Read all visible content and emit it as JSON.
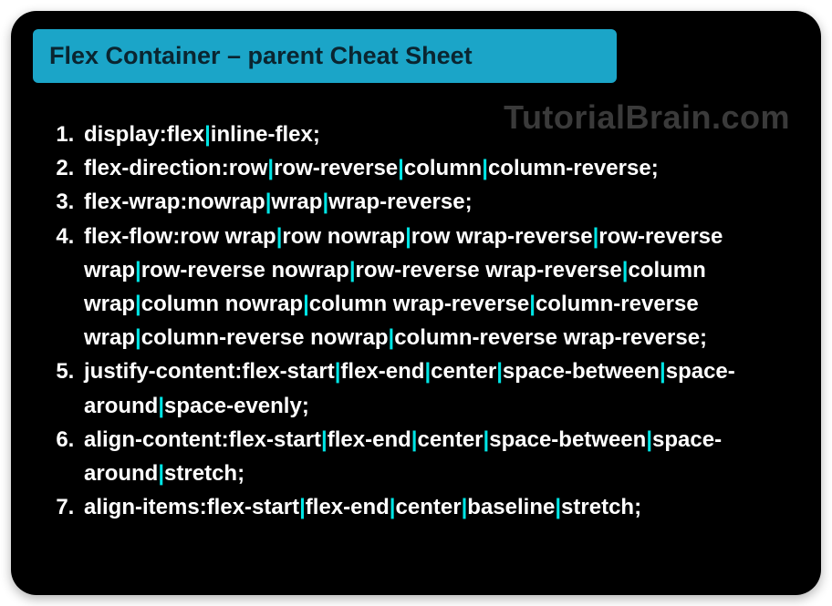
{
  "title": "Flex Container – parent Cheat Sheet",
  "watermark": "TutorialBrain.com",
  "separator": "|",
  "items": [
    {
      "prop": "display:",
      "values": [
        "flex",
        "inline-flex"
      ],
      "end": ";"
    },
    {
      "prop": "flex-direction:",
      "values": [
        "row",
        "row-reverse",
        "column",
        "column-reverse"
      ],
      "end": ";"
    },
    {
      "prop": "flex-wrap:",
      "values": [
        "nowrap",
        "wrap",
        "wrap-reverse"
      ],
      "end": ";"
    },
    {
      "prop": "flex-flow:",
      "values": [
        "row wrap",
        "row nowrap",
        "row wrap-reverse",
        "row-reverse wrap",
        "row-reverse nowrap",
        "row-reverse wrap-reverse",
        "column wrap",
        "column nowrap",
        "column wrap-reverse",
        "column-reverse wrap",
        "column-reverse nowrap",
        "column-reverse wrap-reverse"
      ],
      "end": ";"
    },
    {
      "prop": "justify-content:",
      "values": [
        "flex-start",
        "flex-end",
        "center",
        "space-between",
        "space-around",
        "space-evenly"
      ],
      "end": ";"
    },
    {
      "prop": "align-content:",
      "values": [
        "flex-start",
        "flex-end",
        "center",
        "space-between",
        "space-around",
        "stretch"
      ],
      "end": ";"
    },
    {
      "prop": "align-items:",
      "values": [
        "flex-start",
        "flex-end",
        "center",
        "baseline",
        "stretch"
      ],
      "end": ";"
    }
  ]
}
